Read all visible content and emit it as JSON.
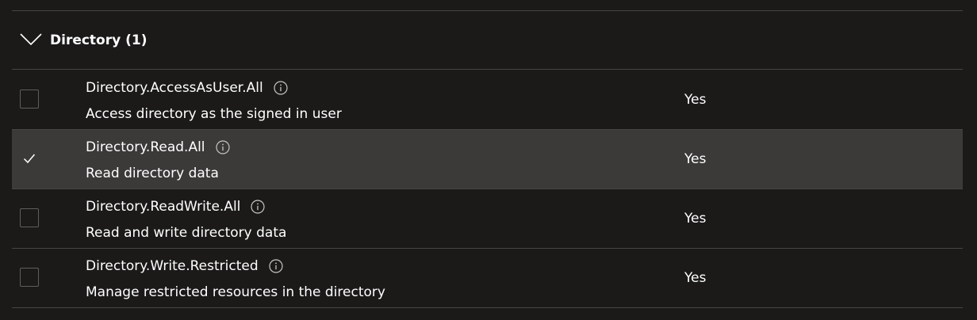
{
  "group": {
    "title": "Directory (1)",
    "expanded": true,
    "chevron_icon": "chevron-down-icon"
  },
  "permissions": [
    {
      "name": "Directory.AccessAsUser.All",
      "description": "Access directory as the signed in user",
      "admin_consent": "Yes",
      "checked": false
    },
    {
      "name": "Directory.Read.All",
      "description": "Read directory data",
      "admin_consent": "Yes",
      "checked": true
    },
    {
      "name": "Directory.ReadWrite.All",
      "description": "Read and write directory data",
      "admin_consent": "Yes",
      "checked": false
    },
    {
      "name": "Directory.Write.Restricted",
      "description": "Manage restricted resources in the directory",
      "admin_consent": "Yes",
      "checked": false
    }
  ],
  "colors": {
    "background": "#1b1a19",
    "selected_row": "#3b3a39",
    "divider": "#484644",
    "text": "#ffffff"
  }
}
